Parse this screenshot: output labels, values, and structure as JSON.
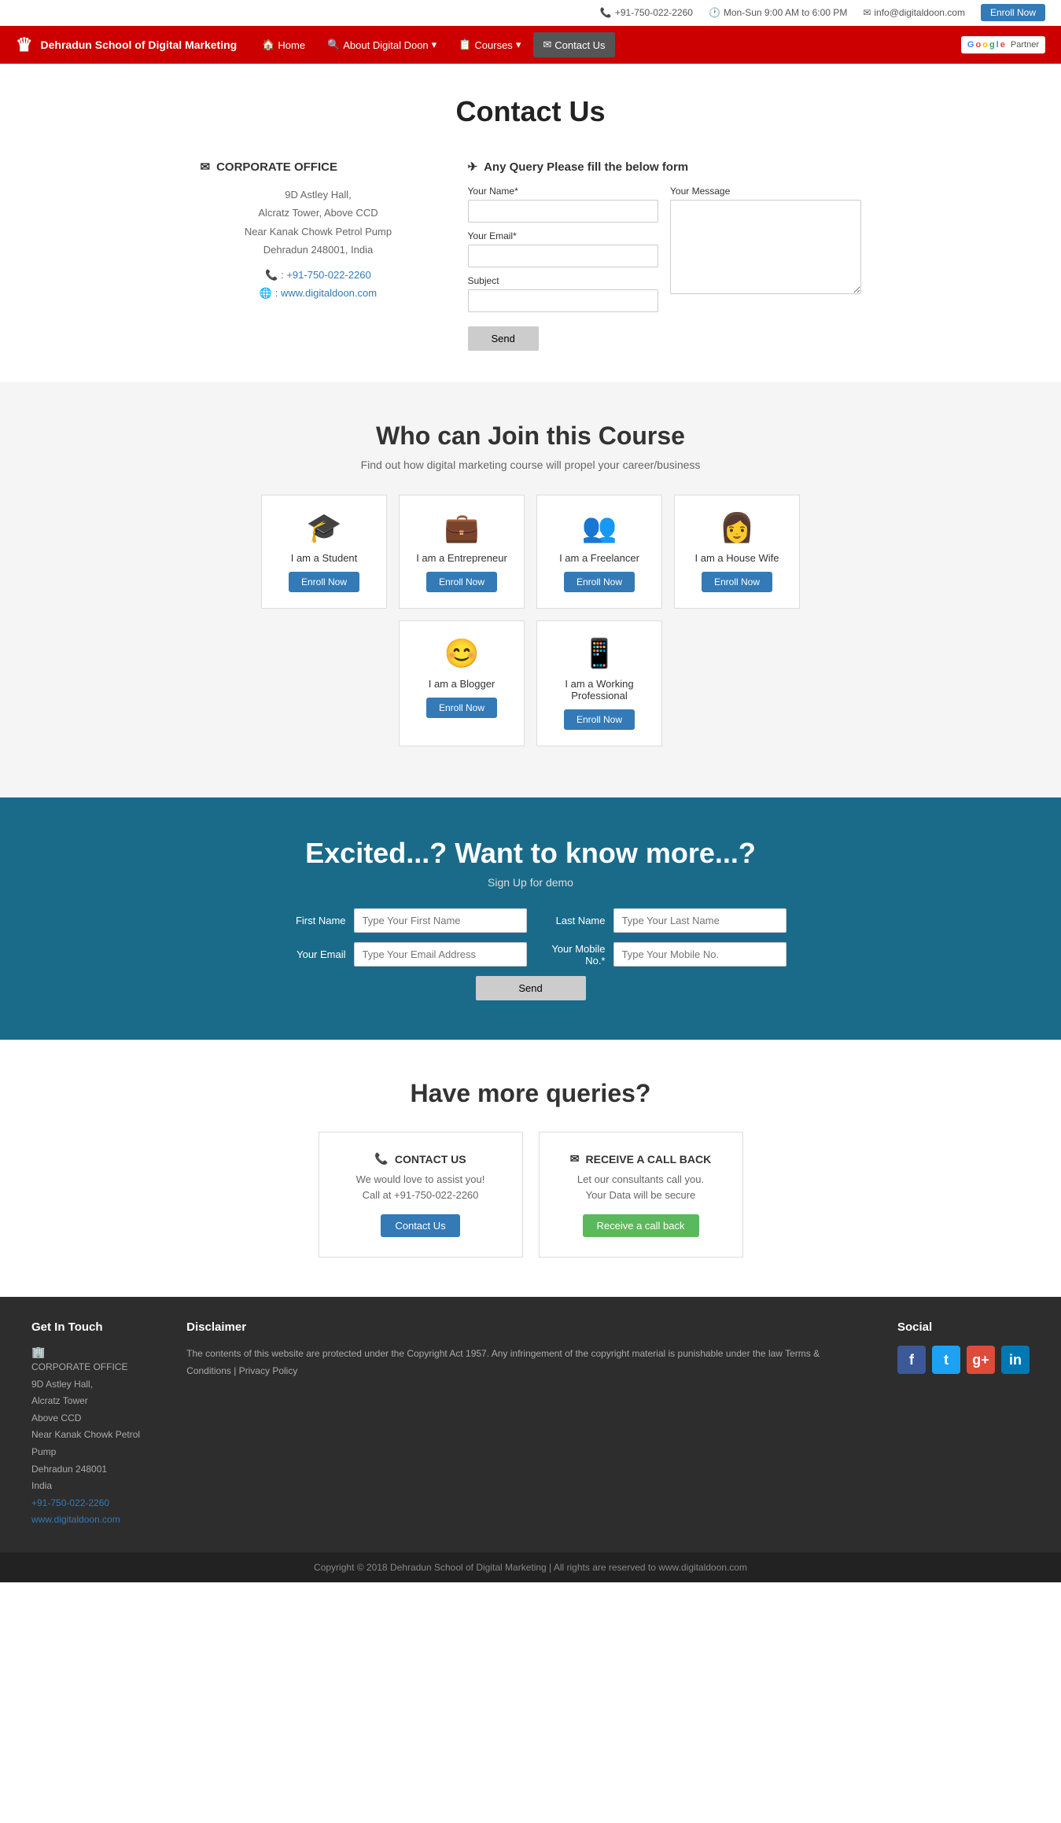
{
  "topbar": {
    "phone": "+91-750-022-2260",
    "hours": "Mon-Sun 9:00 AM to 6:00 PM",
    "email": "info@digitaldoon.com",
    "enroll_label": "Enroll Now"
  },
  "header": {
    "logo_text": "Dehradun School of Digital Marketing",
    "nav": [
      {
        "label": "Home",
        "icon": "🏠"
      },
      {
        "label": "About Digital Doon",
        "icon": "🔍"
      },
      {
        "label": "Courses",
        "icon": "📋"
      },
      {
        "label": "Contact Us",
        "icon": "✉",
        "active": true
      }
    ],
    "partner_label": "Google Partner"
  },
  "contact_page": {
    "title": "Contact Us",
    "office": {
      "section_icon": "✉",
      "section_title": "CORPORATE OFFICE",
      "address_lines": [
        "9D Astley Hall,",
        "Alcratz Tower, Above CCD",
        "Near Kanak Chowk Petrol Pump",
        "Dehradun 248001, India"
      ],
      "phone_label": "📞 :",
      "phone": "+91-750-022-2260",
      "web_label": "🌐 :",
      "website": "www.digitaldoon.com"
    },
    "query_form": {
      "title_icon": "✈",
      "title": "Any Query Please fill the below form",
      "name_label": "Your Name*",
      "email_label": "Your Email*",
      "subject_label": "Subject",
      "message_label": "Your Message",
      "send_label": "Send"
    }
  },
  "join_section": {
    "title": "Who can Join this Course",
    "subtitle": "Find out how digital marketing course will propel your career/business",
    "cards": [
      {
        "icon": "🎓",
        "label": "I am a Student",
        "btn": "Enroll Now"
      },
      {
        "icon": "💼",
        "label": "I am a Entrepreneur",
        "btn": "Enroll Now"
      },
      {
        "icon": "👥",
        "label": "I am a Freelancer",
        "btn": "Enroll Now"
      },
      {
        "icon": "👩",
        "label": "I am a House Wife",
        "btn": "Enroll Now"
      },
      {
        "icon": "😊",
        "label": "I am a Blogger",
        "btn": "Enroll Now"
      },
      {
        "icon": "📱",
        "label": "I am a Working Professional",
        "btn": "Enroll Now"
      }
    ]
  },
  "excited_section": {
    "title": "Excited...? Want to know more...?",
    "signup_label": "Sign Up for demo",
    "first_name_label": "First Name",
    "first_name_placeholder": "Type Your First Name",
    "last_name_label": "Last Name",
    "last_name_placeholder": "Type Your Last Name",
    "email_label": "Your Email",
    "email_placeholder": "Type Your Email Address",
    "mobile_label": "Your Mobile No.*",
    "mobile_placeholder": "Type Your Mobile No.",
    "send_label": "Send"
  },
  "queries_section": {
    "title": "Have more queries?",
    "cards": [
      {
        "icon": "📞",
        "title": "CONTACT US",
        "desc1": "We would love to assist you!",
        "desc2": "Call at +91-750-022-2260",
        "btn_label": "Contact Us",
        "btn_type": "contact"
      },
      {
        "icon": "✉",
        "title": "RECEIVE A CALL BACK",
        "desc1": "Let our consultants call you.",
        "desc2": "Your Data will be secure",
        "btn_label": "Receive a call back",
        "btn_type": "callback"
      }
    ]
  },
  "footer": {
    "col1_title": "Get In Touch",
    "col1_address": "CORPORATE OFFICE\n9D Astley Hall,\nAlcratz Tower\nAbove CCD\nNear Kanak Chowk Petrol Pump\nDehradun 248001\nIndia",
    "col1_phone": "+91-750-022-2260",
    "col1_website": "www.digitaldoon.com",
    "col2_title": "Disclaimer",
    "col2_text": "The contents of this website are protected under the Copyright Act 1957. Any infringement of the copyright material is punishable under the law Terms & Conditions | Privacy Policy",
    "col3_title": "Social",
    "social": [
      {
        "name": "facebook",
        "letter": "f",
        "class": "si-fb"
      },
      {
        "name": "twitter",
        "letter": "t",
        "class": "si-tw"
      },
      {
        "name": "google-plus",
        "letter": "g+",
        "class": "si-gp"
      },
      {
        "name": "linkedin",
        "letter": "in",
        "class": "si-li"
      }
    ],
    "copyright": "Copyright © 2018 Dehradun School of Digital Marketing | All rights are reserved to www.digitaldoon.com"
  }
}
